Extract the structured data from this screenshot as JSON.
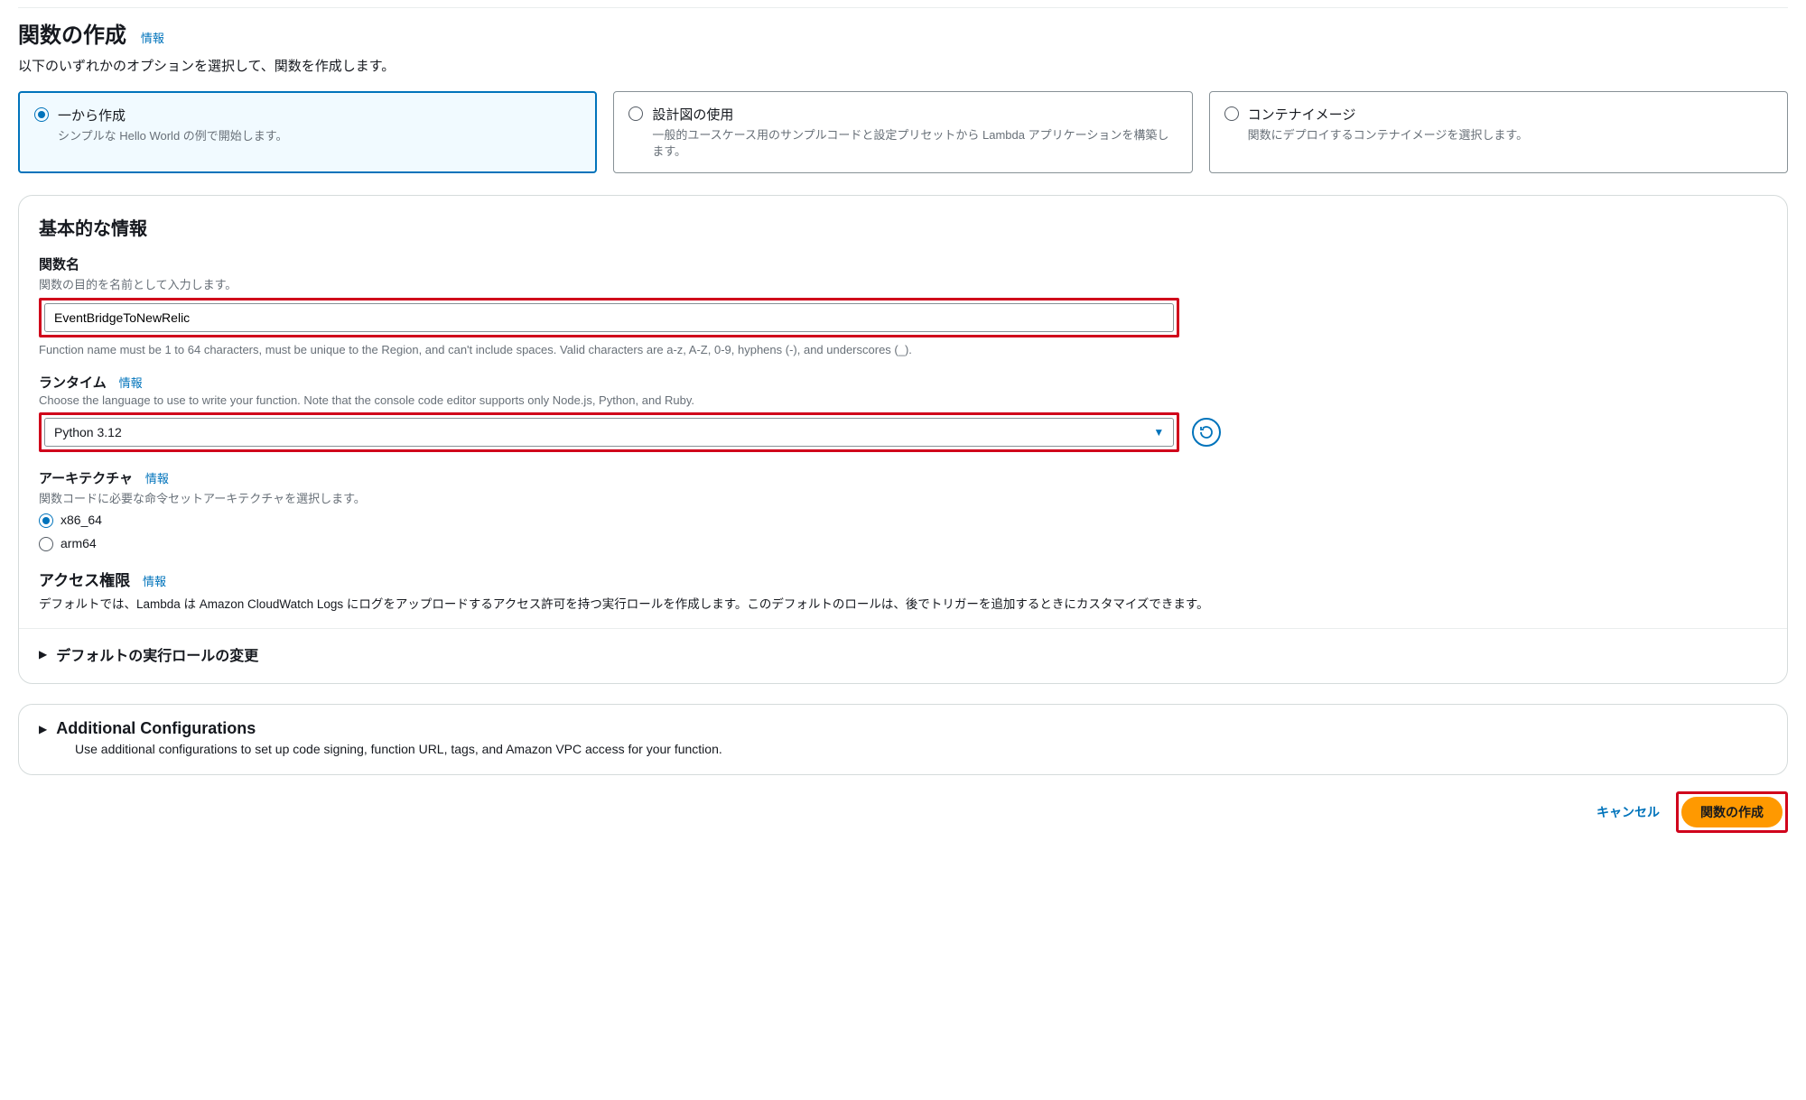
{
  "header": {
    "title": "関数の作成",
    "info": "情報",
    "subtitle": "以下のいずれかのオプションを選択して、関数を作成します。"
  },
  "options": [
    {
      "title": "一から作成",
      "desc": "シンプルな Hello World の例で開始します。",
      "selected": true
    },
    {
      "title": "設計図の使用",
      "desc": "一般的ユースケース用のサンプルコードと設定プリセットから Lambda アプリケーションを構築します。",
      "selected": false
    },
    {
      "title": "コンテナイメージ",
      "desc": "関数にデプロイするコンテナイメージを選択します。",
      "selected": false
    }
  ],
  "basic": {
    "title": "基本的な情報",
    "function_name": {
      "label": "関数名",
      "hint": "関数の目的を名前として入力します。",
      "value": "EventBridgeToNewRelic",
      "constraint": "Function name must be 1 to 64 characters, must be unique to the Region, and can't include spaces. Valid characters are a-z, A-Z, 0-9, hyphens (-), and underscores (_)."
    },
    "runtime": {
      "label": "ランタイム",
      "info": "情報",
      "hint": "Choose the language to use to write your function. Note that the console code editor supports only Node.js, Python, and Ruby.",
      "value": "Python 3.12"
    },
    "architecture": {
      "label": "アーキテクチャ",
      "info": "情報",
      "hint": "関数コードに必要な命令セットアーキテクチャを選択します。",
      "options": [
        {
          "label": "x86_64",
          "selected": true
        },
        {
          "label": "arm64",
          "selected": false
        }
      ]
    },
    "permissions": {
      "label": "アクセス権限",
      "info": "情報",
      "desc": "デフォルトでは、Lambda は Amazon CloudWatch Logs にログをアップロードするアクセス許可を持つ実行ロールを作成します。このデフォルトのロールは、後でトリガーを追加するときにカスタマイズできます。"
    },
    "expand_role": "デフォルトの実行ロールの変更"
  },
  "additional": {
    "title": "Additional Configurations",
    "desc": "Use additional configurations to set up code signing, function URL, tags, and Amazon VPC access for your function."
  },
  "footer": {
    "cancel": "キャンセル",
    "create": "関数の作成"
  }
}
